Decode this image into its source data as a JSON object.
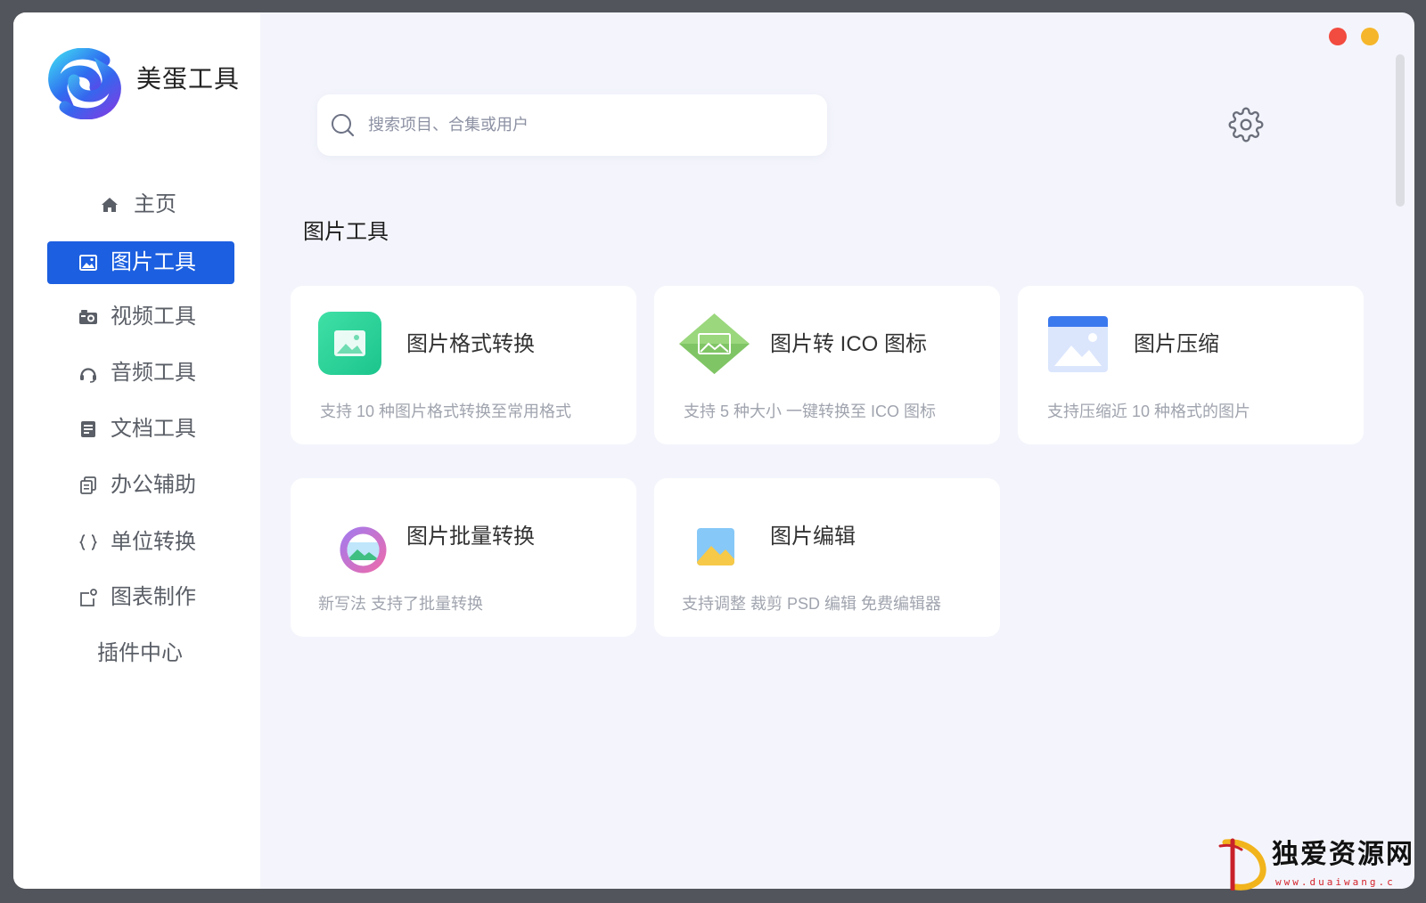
{
  "app": {
    "name": "美蛋工具",
    "window_controls": [
      {
        "name": "close",
        "color": "#f24b3f"
      },
      {
        "name": "minimize",
        "color": "#f6b62b"
      }
    ]
  },
  "colors": {
    "accent": "#1c5fe0",
    "sidebar_bg": "#ffffff",
    "main_bg": "#f4f5fc",
    "card_bg": "#ffffff",
    "text_primary": "#333333",
    "text_secondary": "#a0a4ae"
  },
  "sidebar": {
    "active_index": 1,
    "items": [
      {
        "label": "主页",
        "icon": "home-icon"
      },
      {
        "label": "图片工具",
        "icon": "image-icon"
      },
      {
        "label": "视频工具",
        "icon": "video-icon"
      },
      {
        "label": "音频工具",
        "icon": "headset-icon"
      },
      {
        "label": "文档工具",
        "icon": "document-icon"
      },
      {
        "label": "办公辅助",
        "icon": "office-icon"
      },
      {
        "label": "单位转换",
        "icon": "braces-icon"
      },
      {
        "label": "图表制作",
        "icon": "chart-icon"
      },
      {
        "label": "插件中心"
      }
    ]
  },
  "search": {
    "placeholder": "搜索项目、合集或用户",
    "value": "",
    "icon": "search-icon"
  },
  "header": {
    "settings_icon": "gear-icon"
  },
  "main": {
    "section_title": "图片工具",
    "cards": [
      {
        "title": "图片格式转换",
        "description": "支持 10 种图片格式转换至常用格式",
        "icon": "image-format-convert-icon"
      },
      {
        "title": "图片转 ICO 图标",
        "description": "支持 5 种大小 一键转换至 ICO 图标",
        "icon": "image-to-ico-icon"
      },
      {
        "title": "图片压缩",
        "description": "支持压缩近 10 种格式的图片",
        "icon": "image-compress-icon"
      },
      {
        "title": "图片批量转换",
        "description": "新写法 支持了批量转换",
        "icon": "image-batch-convert-icon"
      },
      {
        "title": "图片编辑",
        "description": "支持调整 裁剪 PSD 编辑  免费编辑器",
        "icon": "image-edit-icon"
      }
    ]
  },
  "watermark": {
    "name": "独爱资源网",
    "url": "www.duaiwang.c"
  }
}
